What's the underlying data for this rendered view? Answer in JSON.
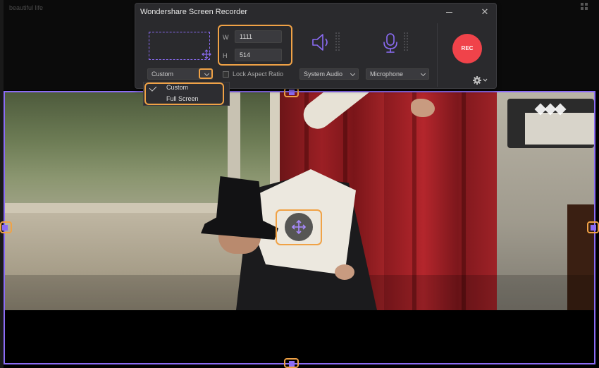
{
  "background": {
    "title": "beautiful life"
  },
  "recorder": {
    "window_title": "Wondershare Screen Recorder",
    "width_label": "W",
    "width_value": "1111",
    "height_label": "H",
    "height_value": "514",
    "region_select": "Custom",
    "lock_aspect_label": "Lock Aspect Ratio",
    "system_audio_select": "System Audio",
    "microphone_select": "Microphone",
    "rec_label": "REC"
  },
  "region_menu": {
    "items": [
      {
        "label": "Custom",
        "checked": true
      },
      {
        "label": "Full Screen",
        "checked": false
      }
    ]
  },
  "colors": {
    "accent_purple": "#8b6cf5",
    "highlight_orange": "#f0a246",
    "rec_red": "#f0434a"
  },
  "icons": [
    "move-icon",
    "speaker-icon",
    "microphone-icon",
    "gear-icon",
    "close-icon",
    "minimize-icon",
    "chevron-down-icon",
    "check-icon",
    "app-grid-icon",
    "logo-icon"
  ]
}
